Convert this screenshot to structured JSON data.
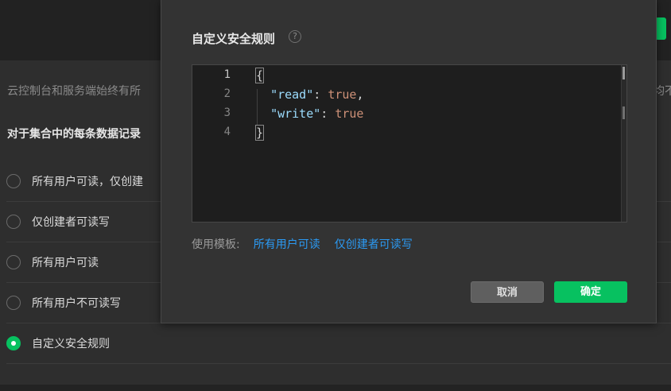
{
  "background": {
    "description_left": "云控制台和服务端始终有所",
    "description_right": "均不",
    "heading": "对于集合中的每条数据记录",
    "options": [
      {
        "label": "所有用户可读，仅创建",
        "checked": false
      },
      {
        "label": "仅创建者可读写",
        "checked": false
      },
      {
        "label": "所有用户可读",
        "checked": false
      },
      {
        "label": "所有用户不可读写",
        "checked": false
      },
      {
        "label": "自定义安全规则",
        "checked": true
      }
    ]
  },
  "modal": {
    "title": "自定义安全规则",
    "help_glyph": "?",
    "editor": {
      "line_numbers": [
        "1",
        "2",
        "3",
        "4"
      ],
      "line1_brace": "{",
      "line2": {
        "key": "\"read\"",
        "colon": ": ",
        "value": "true",
        "trail": ","
      },
      "line3": {
        "key": "\"write\"",
        "colon": ": ",
        "value": "true"
      },
      "line4_brace": "}"
    },
    "templates": {
      "label": "使用模板:",
      "links": [
        "所有用户可读",
        "仅创建者可读写"
      ]
    },
    "cancel_label": "取消",
    "ok_label": "确定"
  },
  "colors": {
    "accent_green": "#07c160",
    "link_blue": "#2b9af3"
  }
}
